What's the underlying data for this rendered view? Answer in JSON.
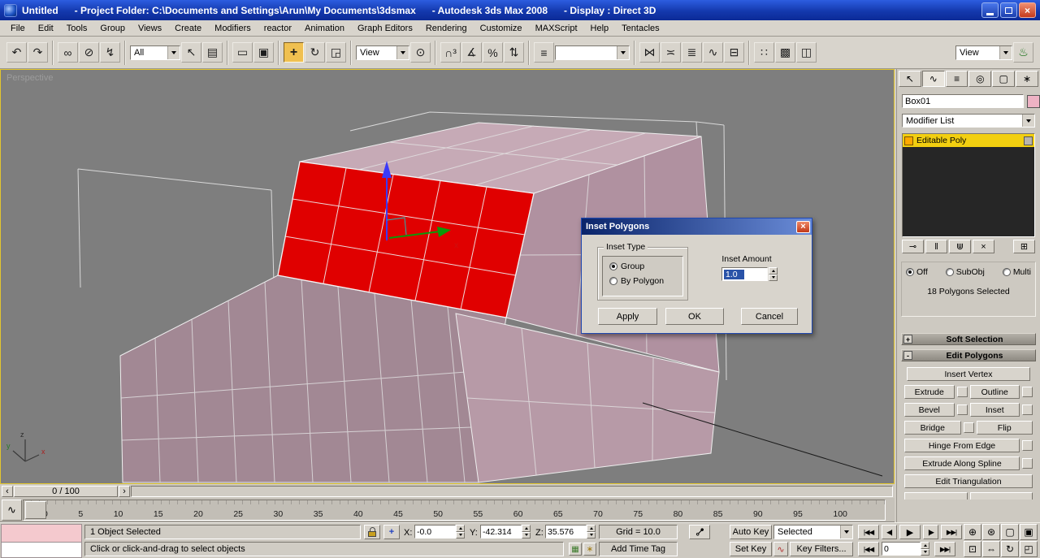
{
  "titlebar": {
    "segments": [
      "Untitled",
      "- Project Folder: C:\\Documents and Settings\\Arun\\My Documents\\3dsmax",
      "- Autodesk 3ds Max 2008",
      "- Display : Direct 3D"
    ]
  },
  "menu": {
    "items": [
      "File",
      "Edit",
      "Tools",
      "Group",
      "Views",
      "Create",
      "Modifiers",
      "reactor",
      "Animation",
      "Graph Editors",
      "Rendering",
      "Customize",
      "MAXScript",
      "Help",
      "Tentacles"
    ]
  },
  "toolbar": {
    "selection_filter": "All",
    "reference_coordsys": "View",
    "render_viewport": "View",
    "named_selection": ""
  },
  "viewport": {
    "label": "Perspective",
    "axis": {
      "x": "x",
      "y": "y",
      "z": "z"
    }
  },
  "dialog": {
    "title": "Inset Polygons",
    "group_label": "Inset Type",
    "radio_group": "Group",
    "radio_by_polygon": "By Polygon",
    "amount_label": "Inset Amount",
    "amount_value": "1.0",
    "apply": "Apply",
    "ok": "OK",
    "cancel": "Cancel"
  },
  "panel": {
    "object_name": "Box01",
    "modifier_list": "Modifier List",
    "stack_item": "Editable Poly",
    "mode_off": "Off",
    "mode_subobj": "SubObj",
    "mode_multi": "Multi",
    "selection_status": "18 Polygons Selected",
    "soft_selection_state": "+",
    "soft_selection": "Soft Selection",
    "edit_polygons_state": "-",
    "edit_polygons": "Edit Polygons",
    "insert_vertex": "Insert Vertex",
    "extrude": "Extrude",
    "outline": "Outline",
    "bevel": "Bevel",
    "inset": "Inset",
    "bridge": "Bridge",
    "flip": "Flip",
    "hinge_from_edge": "Hinge From Edge",
    "extrude_along_spline": "Extrude Along Spline",
    "edit_triangulation": "Edit Triangulation"
  },
  "timeslider": {
    "value": "0 / 100"
  },
  "trackbar": {
    "ticks": [
      "0",
      "5",
      "10",
      "15",
      "20",
      "25",
      "30",
      "35",
      "40",
      "45",
      "50",
      "55",
      "60",
      "65",
      "70",
      "75",
      "80",
      "85",
      "90",
      "95",
      "100"
    ]
  },
  "status": {
    "selection_info": "1 Object Selected",
    "prompt": "Click or click-and-drag to select objects",
    "x_label": "X:",
    "x_value": "-0.0",
    "y_label": "Y:",
    "y_value": "-42.314",
    "z_label": "Z:",
    "z_value": "35.576",
    "grid": "Grid = 10.0",
    "add_time_tag": "Add Time Tag"
  },
  "anim": {
    "auto_key": "Auto Key",
    "set_key": "Set Key",
    "selected": "Selected",
    "key_filters": "Key Filters...",
    "frame": "0"
  },
  "icons": {
    "undo": "↶",
    "redo": "↷",
    "select_link": "∞",
    "unlink": "⊘",
    "bind_spacewarp": "↯",
    "select": "↖",
    "select_by_name": "▤",
    "rect_region": "▭",
    "window_crossing": "▣",
    "move": "+",
    "rotate": "↻",
    "scale": "◲",
    "use_pivot": "⊙",
    "snaps_3d": "∩³",
    "angle_snap": "∡",
    "percent_snap": "%",
    "spinner_snap": "⇅",
    "named_sets": "≡",
    "mirror": "⋈",
    "align": "≍",
    "layers": "≣",
    "curve_editor": "∿",
    "schematic_view": "⊟",
    "material_editor": "∷",
    "render_setup": "▩",
    "render_frame": "◫",
    "quick_render": "♨",
    "panel_create": "↖",
    "panel_modify": "∿",
    "panel_hierarchy": "≡",
    "panel_motion": "◎",
    "panel_display": "▢",
    "panel_utilities": "∗",
    "pin_stack": "⊸",
    "show_end_result": "‖",
    "make_unique": "⋓",
    "remove_modifier": "×",
    "configure_modifier": "⊞",
    "ts_prev": "‹",
    "ts_next": "›",
    "trackbar_curve": "∿",
    "key": "⊶",
    "absolute_offset": "+",
    "keyboard_override": "▦",
    "selection_lock": "∗",
    "setkey_curve": "∿",
    "play_start": "|◀◀",
    "play_prev": "◀|",
    "play": "▶",
    "play_next": "|▶",
    "play_end": "▶▶|",
    "frame_start": "|◀◀",
    "frame_end": "▶▶|",
    "zoom": "⊕",
    "zoom_all": "⊛",
    "zoom_extents": "▢",
    "zoom_extents_all": "▣",
    "zoom_region": "⊡",
    "pan": "⇔",
    "orbit": "↻",
    "maximize": "◰",
    "close_x": "×"
  },
  "colors": {
    "viewport_bg": "#7e7e7e",
    "model_mauve": "#b69aa7",
    "selected_faces_red": "#e00000",
    "active_viewport_border": "#e2c62e",
    "stack_highlight_yellow": "#f2cf10",
    "titlebar_blue": "#1439ae",
    "object_color_swatch": "#eeb2c4"
  }
}
